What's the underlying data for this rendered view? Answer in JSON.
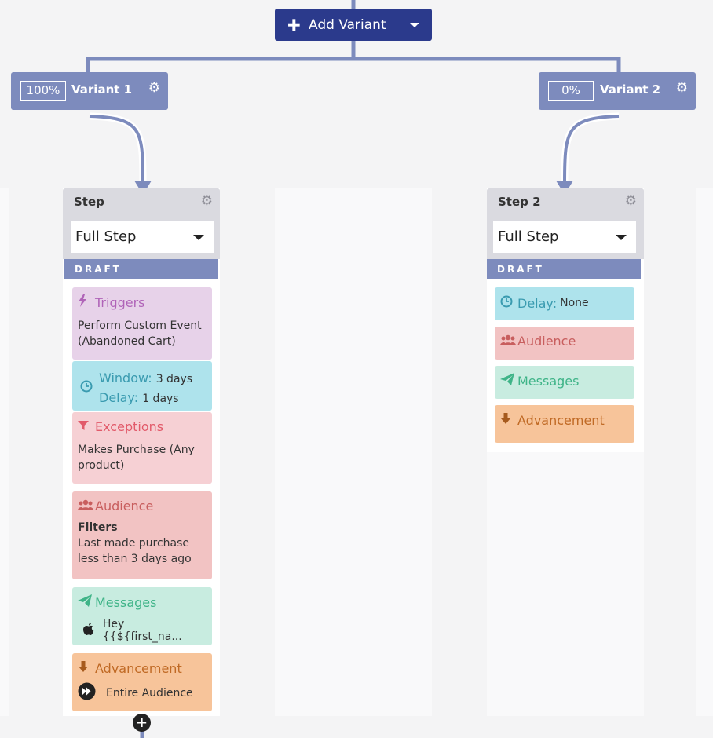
{
  "toolbar": {
    "add_variant_label": "Add Variant"
  },
  "variants": [
    {
      "percent": "100%",
      "name": "Variant 1"
    },
    {
      "percent": "0%",
      "name": "Variant 2"
    }
  ],
  "steps": [
    {
      "title": "Step",
      "type": "Full Step",
      "status": "DRAFT",
      "triggers": {
        "label": "Triggers",
        "value": "Perform Custom Event (Abandoned Cart)"
      },
      "window": {
        "label": "Window:",
        "value": "3 days"
      },
      "delay": {
        "label": "Delay:",
        "value": "1 days"
      },
      "exceptions": {
        "label": "Exceptions",
        "value": "Makes Purchase (Any product)"
      },
      "audience": {
        "label": "Audience",
        "subheading": "Filters",
        "value": "Last made purchase less than 3 days ago"
      },
      "messages": {
        "label": "Messages",
        "value": "Hey {{${first_na..."
      },
      "advancement": {
        "label": "Advancement",
        "value": "Entire Audience"
      }
    },
    {
      "title": "Step 2",
      "type": "Full Step",
      "status": "DRAFT",
      "delay": {
        "label": "Delay:",
        "value": "None"
      },
      "audience": {
        "label": "Audience"
      },
      "messages": {
        "label": "Messages"
      },
      "advancement": {
        "label": "Advancement"
      }
    }
  ],
  "colors": {
    "primary": "#2b3a8c",
    "variant": "#7d8bbd",
    "triggers": "#e7d2e9",
    "delay": "#aee3ec",
    "exceptions": "#f6d0d4",
    "audience": "#f2c3c3",
    "messages": "#c8ece0",
    "advancement": "#f7c49a"
  },
  "icons": [
    "plus-icon",
    "chevron-down-icon",
    "gear-icon",
    "lightning-icon",
    "clock-icon",
    "filter-icon",
    "users-icon",
    "paper-plane-icon",
    "arrow-down-icon",
    "apple-icon",
    "fast-forward-icon",
    "plus-circle-icon"
  ]
}
